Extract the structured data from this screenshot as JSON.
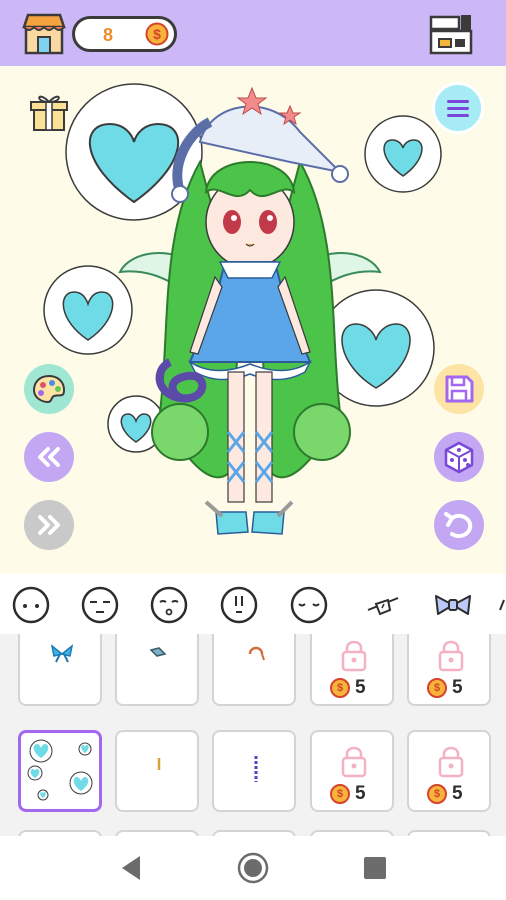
{
  "top_bar": {
    "coin_count": "8",
    "coin_symbol": "$"
  },
  "colors": {
    "top_bar_bg": "#cdb8f7",
    "stage_bg": "#fefbe8",
    "heart": "#6fdbe6",
    "accent_purple": "#a467ef",
    "price_coin": "#f6b43a"
  },
  "icons": {
    "shop": "shop-icon",
    "coin": "coin-icon",
    "wardrobe": "wardrobe-icon",
    "gift": "gift-icon",
    "menu": "menu-icon",
    "palette": "palette-icon",
    "previous": "double-chevron-left-icon",
    "next": "double-chevron-right-icon",
    "save": "floppy-disk-icon",
    "random": "dice-icon",
    "undo": "undo-icon"
  },
  "category_tabs": [
    {
      "name": "face-neutral"
    },
    {
      "name": "face-closed-eyes"
    },
    {
      "name": "face-open-mouth"
    },
    {
      "name": "face-side"
    },
    {
      "name": "face-calm"
    },
    {
      "name": "eye-patch"
    },
    {
      "name": "bow"
    }
  ],
  "items": {
    "row1": [
      {
        "locked": false,
        "content": "blue-bow"
      },
      {
        "locked": false,
        "content": "small-clip"
      },
      {
        "locked": false,
        "content": "orange-clip"
      },
      {
        "locked": true,
        "price": "5",
        "coin_symbol": "$"
      },
      {
        "locked": true,
        "price": "5",
        "coin_symbol": "$"
      }
    ],
    "row2": [
      {
        "locked": false,
        "selected": true,
        "content": "heart-stickers"
      },
      {
        "locked": false,
        "content": "gold-pin"
      },
      {
        "locked": false,
        "content": "purple-chain"
      },
      {
        "locked": true,
        "price": "5",
        "coin_symbol": "$"
      },
      {
        "locked": true,
        "price": "5",
        "coin_symbol": "$"
      }
    ]
  }
}
